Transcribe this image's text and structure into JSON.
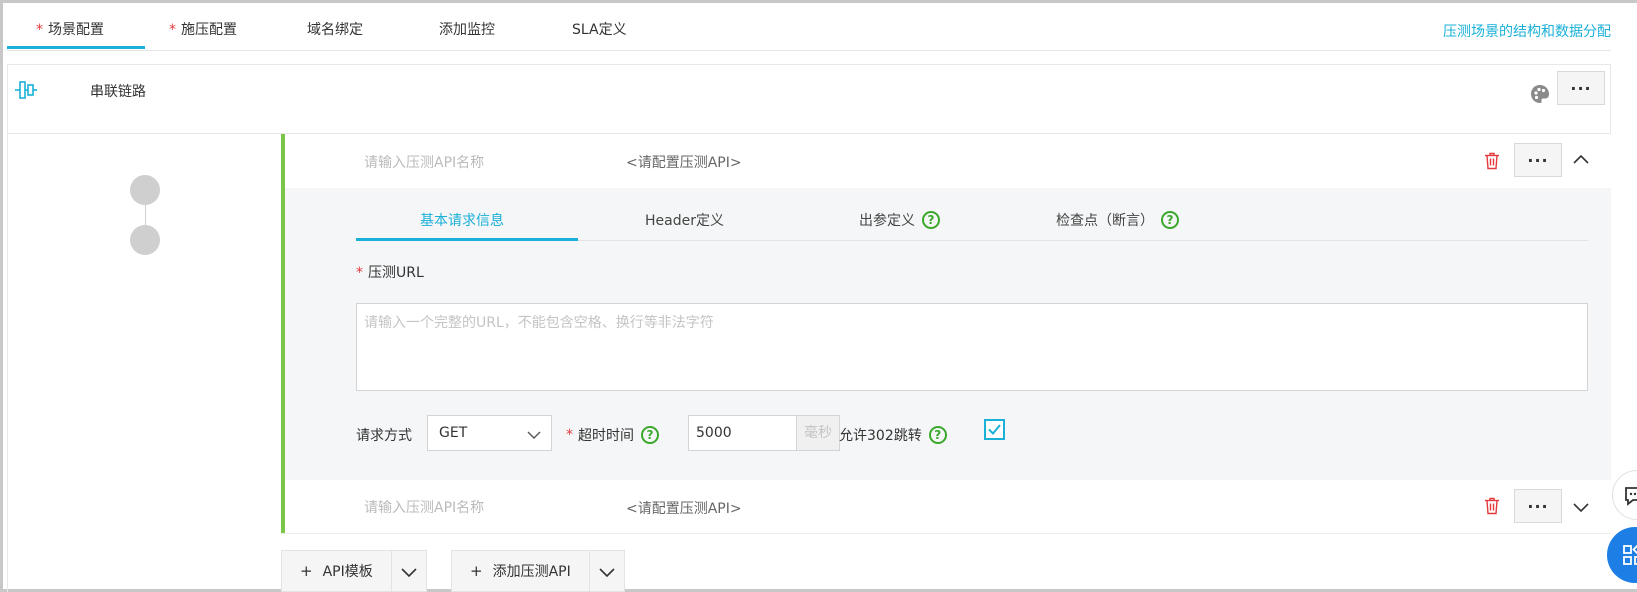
{
  "tabs": [
    {
      "label": "场景配置",
      "required": true,
      "active": true
    },
    {
      "label": "施压配置",
      "required": true,
      "active": false
    },
    {
      "label": "域名绑定",
      "required": false,
      "active": false
    },
    {
      "label": "添加监控",
      "required": false,
      "active": false
    },
    {
      "label": "SLA定义",
      "required": false,
      "active": false
    }
  ],
  "tab_link": "压测场景的结构和数据分配",
  "required_mark": "*",
  "chain": {
    "title": "串联链路",
    "more_label": "···"
  },
  "apis": [
    {
      "name_placeholder": "请输入压测API名称",
      "config": "<请配置压测API>",
      "expanded": true
    },
    {
      "name_placeholder": "请输入压测API名称",
      "config": "<请配置压测API>",
      "expanded": false
    }
  ],
  "detail": {
    "subtabs": [
      {
        "label": "基本请求信息",
        "active": true,
        "help": false
      },
      {
        "label": "Header定义",
        "active": false,
        "help": false
      },
      {
        "label": "出参定义",
        "active": false,
        "help": true
      },
      {
        "label": "检查点（断言）",
        "active": false,
        "help": true
      }
    ],
    "help_glyph": "?",
    "url_label": "压测URL",
    "url_placeholder": "请输入一个完整的URL，不能包含空格、换行等非法字符",
    "method_label": "请求方式",
    "method_value": "GET",
    "timeout_label": "超时时间",
    "timeout_value": "5000",
    "timeout_unit": "毫秒",
    "redirect_label": "允许302跳转",
    "redirect_checked": true
  },
  "buttons": {
    "plus": "+",
    "api_template": "API模板",
    "add_api": "添加压测API"
  },
  "colors": {
    "accent": "#1ab0d8",
    "green": "#7bc549",
    "required": "#e4393c",
    "trash": "#e4393c"
  }
}
